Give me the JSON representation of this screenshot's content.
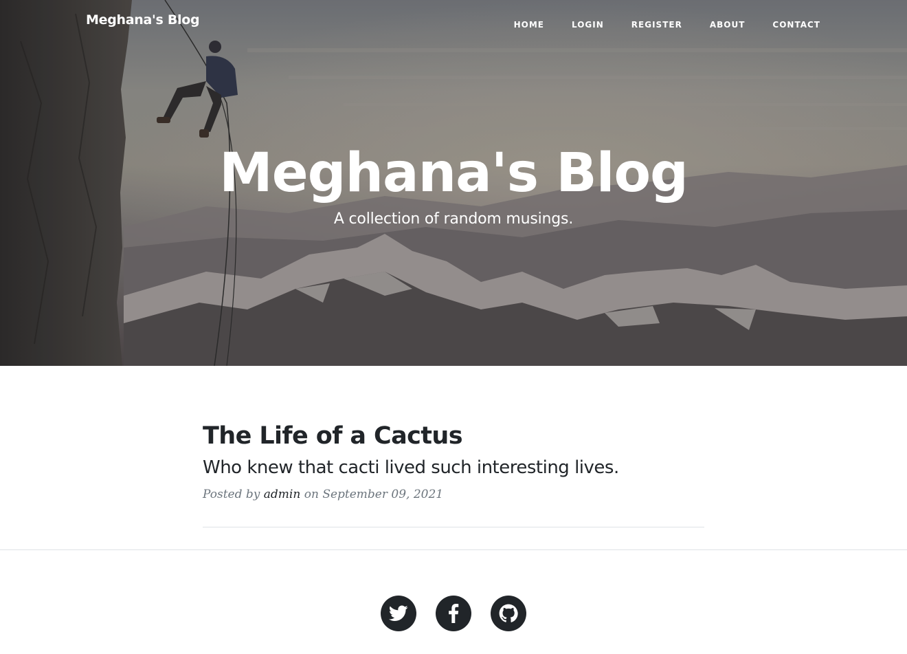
{
  "nav": {
    "brand": "Meghana's Blog",
    "links": [
      {
        "label": "Home"
      },
      {
        "label": "Login"
      },
      {
        "label": "Register"
      },
      {
        "label": "About"
      },
      {
        "label": "Contact"
      }
    ]
  },
  "header": {
    "title": "Meghana's Blog",
    "subtitle": "A collection of random musings."
  },
  "posts": [
    {
      "title": "The Life of a Cactus",
      "subtitle": "Who knew that cacti lived such interesting lives.",
      "meta_prefix": "Posted by",
      "author": "admin",
      "meta_on": "on",
      "date": "September 09, 2021"
    }
  ],
  "footer": {
    "social": [
      {
        "icon": "twitter-icon"
      },
      {
        "icon": "facebook-icon"
      },
      {
        "icon": "github-icon"
      }
    ]
  },
  "colors": {
    "text_dark": "#212529",
    "muted": "#6c757d",
    "divider": "#dee2e6",
    "social_bg": "#212529"
  }
}
